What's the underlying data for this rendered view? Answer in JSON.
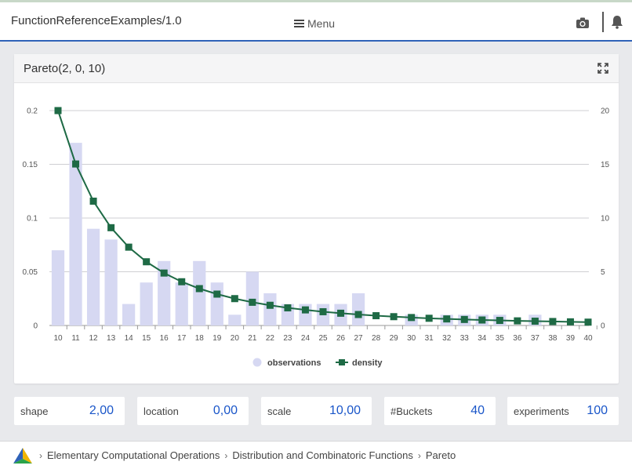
{
  "header": {
    "app_title": "FunctionReferenceExamples/1.0",
    "menu_label": "Menu",
    "camera_icon": "camera-icon",
    "bell_icon": "bell-icon",
    "accent_color": "#2f62b8"
  },
  "panel": {
    "title": "Pareto(2, 0, 10)",
    "expand_icon": "expand-icon"
  },
  "chart_data": {
    "type": "bar",
    "categories": [
      "10",
      "11",
      "12",
      "13",
      "14",
      "15",
      "16",
      "17",
      "18",
      "19",
      "20",
      "21",
      "22",
      "23",
      "24",
      "25",
      "26",
      "27",
      "28",
      "29",
      "30",
      "31",
      "32",
      "33",
      "34",
      "35",
      "36",
      "37",
      "38",
      "39",
      "40"
    ],
    "series": [
      {
        "name": "observations",
        "type": "bar",
        "axis": "left",
        "color": "#d6d8f2",
        "values": [
          0.07,
          0.17,
          0.09,
          0.08,
          0.02,
          0.04,
          0.06,
          0.04,
          0.06,
          0.04,
          0.01,
          0.05,
          0.03,
          0.02,
          0.02,
          0.02,
          0.02,
          0.03,
          0,
          0,
          0.01,
          0,
          0.01,
          0.01,
          0.01,
          0.01,
          0,
          0.01,
          0,
          0,
          0
        ]
      },
      {
        "name": "density",
        "type": "line",
        "axis": "right",
        "color": "#1e6a45",
        "values": [
          20.0,
          15.03,
          11.57,
          9.1,
          7.29,
          5.93,
          4.88,
          4.07,
          3.43,
          2.92,
          2.5,
          2.16,
          1.88,
          1.64,
          1.45,
          1.28,
          1.14,
          1.02,
          0.91,
          0.82,
          0.74,
          0.67,
          0.61,
          0.56,
          0.51,
          0.47,
          0.43,
          0.4,
          0.37,
          0.34,
          0.31
        ]
      }
    ],
    "left_ticks": [
      "0",
      "0.05",
      "0.1",
      "0.15",
      "0.2"
    ],
    "right_ticks": [
      "0",
      "5",
      "10",
      "15",
      "20"
    ],
    "ylim_left": [
      0,
      0.2
    ],
    "ylim_right": [
      0,
      20
    ],
    "grid": true,
    "legend": "bottom-center"
  },
  "params": [
    {
      "label": "shape",
      "value": "2,00"
    },
    {
      "label": "location",
      "value": "0,00"
    },
    {
      "label": "scale",
      "value": "10,00"
    },
    {
      "label": "#Buckets",
      "value": "40"
    },
    {
      "label": "experiments",
      "value": "100"
    }
  ],
  "breadcrumb": {
    "logo_icon": "pyramid-logo-icon",
    "items": [
      "Elementary Computational Operations",
      "Distribution and Combinatoric Functions",
      "Pareto"
    ]
  }
}
